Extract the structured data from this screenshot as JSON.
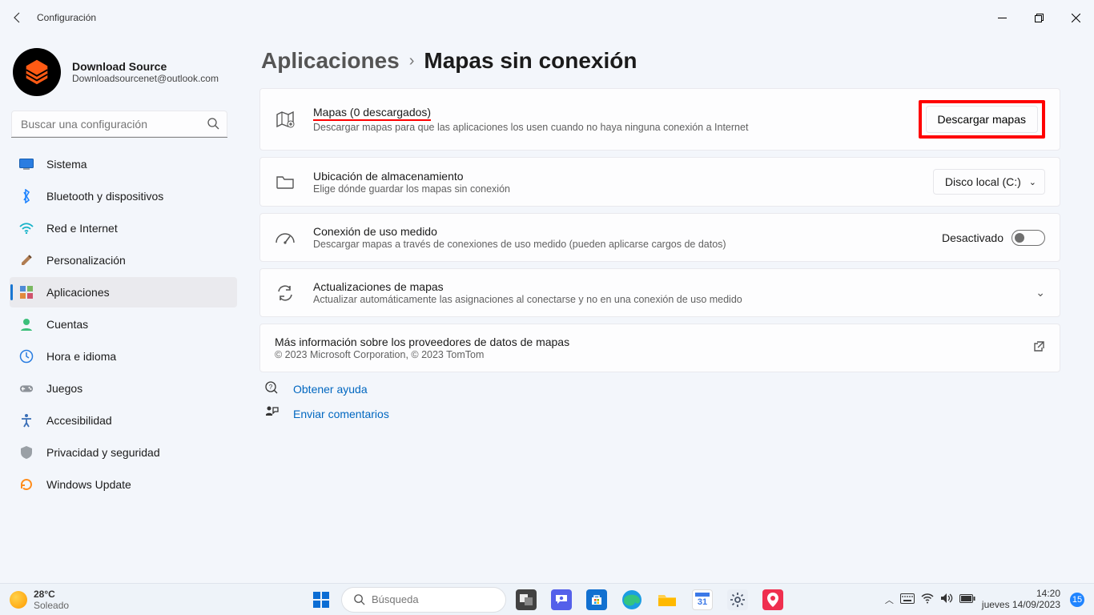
{
  "window": {
    "title": "Configuración",
    "controls": {
      "minimize": "–",
      "maximize": "▢",
      "close": "✕"
    }
  },
  "profile": {
    "name": "Download Source",
    "email": "Downloadsourcenet@outlook.com"
  },
  "search": {
    "placeholder": "Buscar una configuración"
  },
  "nav": {
    "items": [
      {
        "label": "Sistema",
        "icon": "monitor"
      },
      {
        "label": "Bluetooth y dispositivos",
        "icon": "bluetooth"
      },
      {
        "label": "Red e Internet",
        "icon": "wifi"
      },
      {
        "label": "Personalización",
        "icon": "paint"
      },
      {
        "label": "Aplicaciones",
        "icon": "apps",
        "active": true
      },
      {
        "label": "Cuentas",
        "icon": "person"
      },
      {
        "label": "Hora e idioma",
        "icon": "clock"
      },
      {
        "label": "Juegos",
        "icon": "games"
      },
      {
        "label": "Accesibilidad",
        "icon": "access"
      },
      {
        "label": "Privacidad y seguridad",
        "icon": "shield"
      },
      {
        "label": "Windows Update",
        "icon": "update"
      }
    ]
  },
  "breadcrumb": {
    "parent": "Aplicaciones",
    "page": "Mapas sin conexión"
  },
  "cards": {
    "maps": {
      "title": "Mapas (0 descargados)",
      "desc": "Descargar mapas para que las aplicaciones los usen cuando no haya ninguna conexión a Internet",
      "button": "Descargar mapas"
    },
    "storage": {
      "title": "Ubicación de almacenamiento",
      "desc": "Elige dónde guardar los mapas sin conexión",
      "selected": "Disco local (C:)"
    },
    "metered": {
      "title": "Conexión de uso medido",
      "desc": "Descargar mapas a través de conexiones de uso medido (pueden aplicarse cargos de datos)",
      "state": "Desactivado"
    },
    "updates": {
      "title": "Actualizaciones de mapas",
      "desc": "Actualizar automáticamente las asignaciones al conectarse y no en una conexión de uso medido"
    },
    "info": {
      "title": "Más información sobre los proveedores de datos de mapas",
      "desc": "© 2023 Microsoft Corporation, © 2023 TomTom"
    }
  },
  "links": {
    "help": "Obtener ayuda",
    "feedback": "Enviar comentarios"
  },
  "taskbar": {
    "weather": {
      "temp": "28°C",
      "cond": "Soleado"
    },
    "search_placeholder": "Búsqueda",
    "clock": {
      "time": "14:20",
      "date": "jueves 14/09/2023"
    },
    "badge": "15"
  }
}
